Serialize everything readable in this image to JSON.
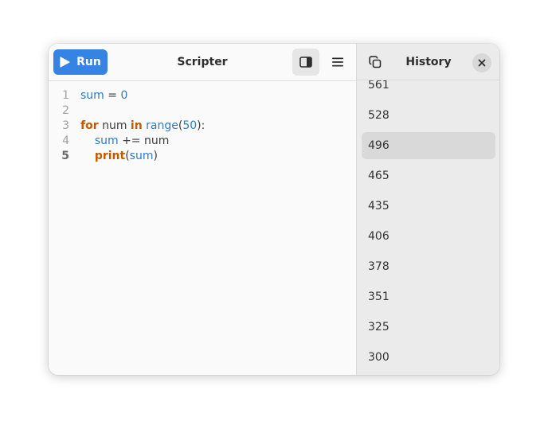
{
  "app": {
    "title": "Scripter",
    "run_label": "Run"
  },
  "editor": {
    "lines": [
      {
        "n": "1",
        "tokens": [
          [
            "var",
            "sum"
          ],
          [
            "plain",
            " = "
          ],
          [
            "num",
            "0"
          ]
        ]
      },
      {
        "n": "2",
        "tokens": []
      },
      {
        "n": "3",
        "tokens": [
          [
            "kw",
            "for"
          ],
          [
            "plain",
            " num "
          ],
          [
            "kw",
            "in"
          ],
          [
            "plain",
            " "
          ],
          [
            "builtin",
            "range"
          ],
          [
            "plain",
            "("
          ],
          [
            "num",
            "50"
          ],
          [
            "plain",
            "):"
          ]
        ]
      },
      {
        "n": "4",
        "tokens": [
          [
            "plain",
            "    "
          ],
          [
            "var",
            "sum"
          ],
          [
            "plain",
            " += num"
          ]
        ]
      },
      {
        "n": "5",
        "tokens": [
          [
            "plain",
            "    "
          ],
          [
            "func",
            "print"
          ],
          [
            "plain",
            "("
          ],
          [
            "var",
            "sum"
          ],
          [
            "plain",
            ")"
          ]
        ]
      }
    ],
    "current_line": "5"
  },
  "sidebar": {
    "title": "History",
    "items": [
      "561",
      "528",
      "496",
      "465",
      "435",
      "406",
      "378",
      "351",
      "325",
      "300"
    ],
    "selected": "496"
  },
  "icons": {
    "run": "play-icon",
    "sidebar_toggle": "sidebar-panel-icon",
    "menu": "hamburger-menu-icon",
    "copy": "copy-icon",
    "close": "close-icon"
  },
  "colors": {
    "accent": "#3584e4",
    "keyword": "#c25b00",
    "identifier": "#2f7bc0"
  }
}
